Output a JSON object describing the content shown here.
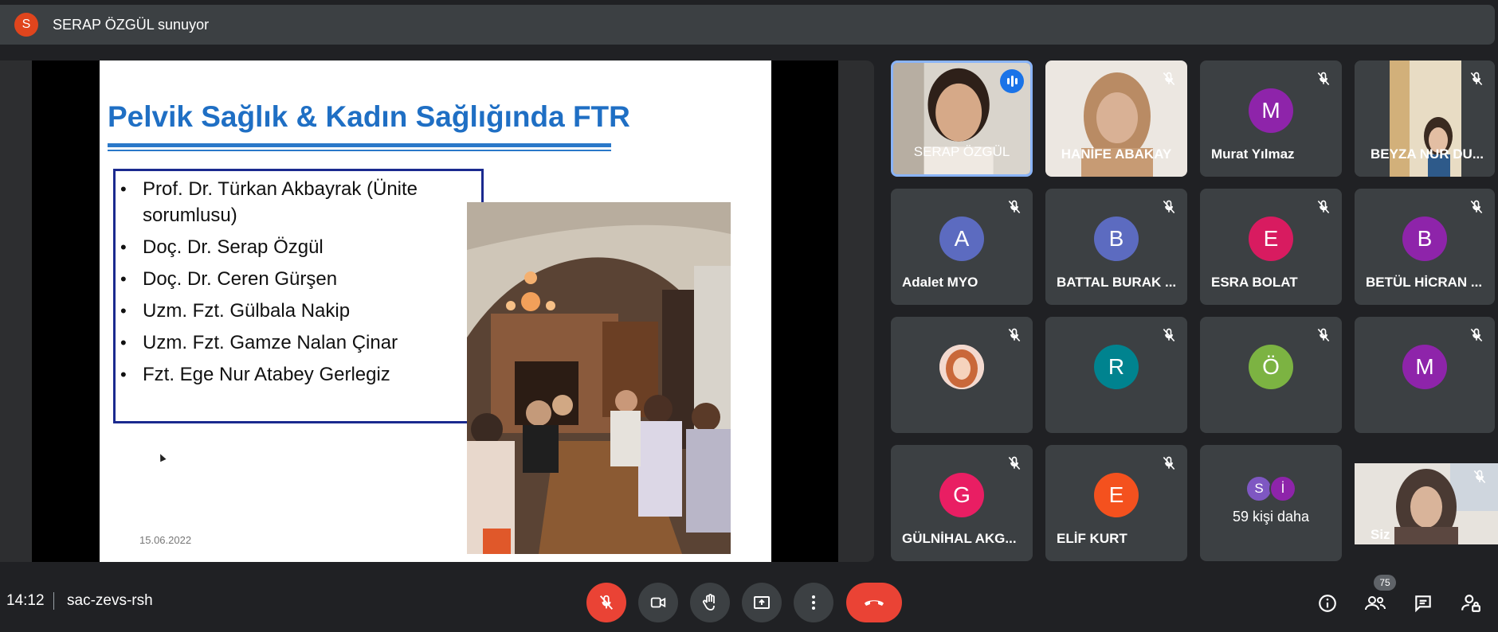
{
  "presenter": {
    "initial": "S",
    "banner": "SERAP ÖZGÜL sunuyor"
  },
  "slide": {
    "title": "Pelvik Sağlık & Kadın Sağlığında FTR",
    "members": [
      "Prof. Dr. Türkan Akbayrak (Ünite sorumlusu)",
      "Doç. Dr. Serap Özgül",
      "Doç. Dr. Ceren Gürşen",
      "Uzm. Fzt. Gülbala Nakip",
      "Uzm. Fzt. Gamze Nalan Çinar",
      "Fzt. Ege Nur Atabey Gerlegiz"
    ],
    "date": "15.06.2022"
  },
  "participants": [
    {
      "name": "SERAP ÖZGÜL",
      "type": "video",
      "speaking": true
    },
    {
      "name": "HANİFE ABAKAY",
      "type": "video"
    },
    {
      "name": "Murat Yılmaz",
      "initial": "M",
      "color": "#8e24aa"
    },
    {
      "name": "BEYZA NUR DU...",
      "type": "video"
    },
    {
      "name": "Adalet MYO",
      "initial": "A",
      "color": "#5c6bc0"
    },
    {
      "name": "BATTAL BURAK ...",
      "initial": "B",
      "color": "#5c6bc0"
    },
    {
      "name": "ESRA BOLAT",
      "initial": "E",
      "color": "#d81b60"
    },
    {
      "name": "BETÜL HİCRAN ...",
      "initial": "B",
      "color": "#8e24aa"
    },
    {
      "name": "",
      "type": "photo"
    },
    {
      "name": "",
      "initial": "R",
      "color": "#00838f"
    },
    {
      "name": "",
      "initial": "Ö",
      "color": "#7cb342"
    },
    {
      "name": "",
      "initial": "M",
      "color": "#8e24aa"
    },
    {
      "name": "GÜLNİHAL AKG...",
      "initial": "G",
      "color": "#e91e63"
    },
    {
      "name": "ELİF KURT",
      "initial": "E",
      "color": "#f4511e"
    }
  ],
  "more": {
    "label": "59 kişi daha",
    "initials": [
      "S",
      "İ"
    ],
    "colors": [
      "#7e57c2",
      "#8e24aa"
    ]
  },
  "self": {
    "name": "Siz"
  },
  "bottom": {
    "time": "14:12",
    "meeting_code": "sac-zevs-rsh",
    "participant_count": "75"
  }
}
